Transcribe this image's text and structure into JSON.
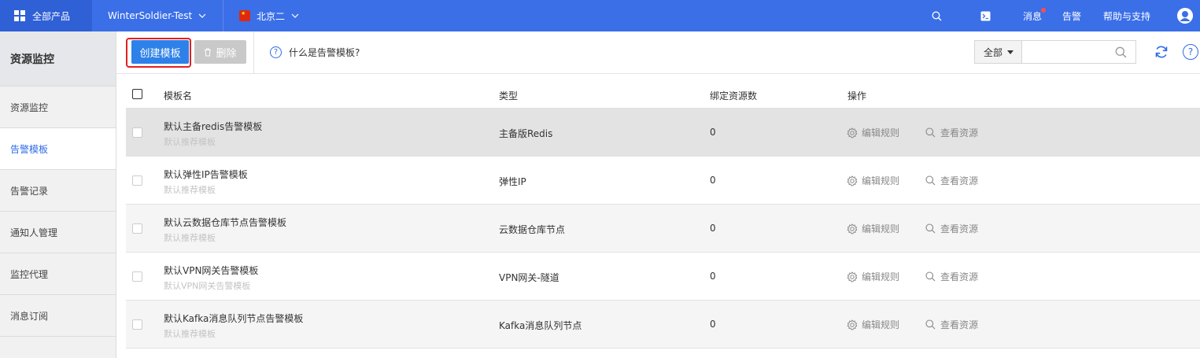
{
  "topbar": {
    "products_label": "全部产品",
    "project_label": "WinterSoldier-Test",
    "region_label": "北京二",
    "messages_label": "消息",
    "alarm_label": "告警",
    "help_label": "帮助与支持"
  },
  "sidebar": {
    "title": "资源监控",
    "items": [
      {
        "label": "资源监控"
      },
      {
        "label": "告警模板"
      },
      {
        "label": "告警记录"
      },
      {
        "label": "通知人管理"
      },
      {
        "label": "监控代理"
      },
      {
        "label": "消息订阅"
      }
    ]
  },
  "toolbar": {
    "create_label": "创建模板",
    "delete_label": "删除",
    "help_text": "什么是告警模板?",
    "filter_value": "全部",
    "search_placeholder": ""
  },
  "table": {
    "headers": {
      "name": "模板名",
      "type": "类型",
      "count": "绑定资源数",
      "ops": "操作"
    },
    "op_edit_label": "编辑规则",
    "op_view_label": "查看资源",
    "rows": [
      {
        "name": "默认主备redis告警模板",
        "sub": "默认推荐模板",
        "type": "主备版Redis",
        "count": "0"
      },
      {
        "name": "默认弹性IP告警模板",
        "sub": "默认推荐模板",
        "type": "弹性IP",
        "count": "0"
      },
      {
        "name": "默认云数据仓库节点告警模板",
        "sub": "默认推荐模板",
        "type": "云数据仓库节点",
        "count": "0"
      },
      {
        "name": "默认VPN网关告警模板",
        "sub": "默认VPN网关告警模板",
        "type": "VPN网关-隧道",
        "count": "0"
      },
      {
        "name": "默认Kafka消息队列节点告警模板",
        "sub": "默认推荐模板",
        "type": "Kafka消息队列节点",
        "count": "0"
      }
    ]
  }
}
